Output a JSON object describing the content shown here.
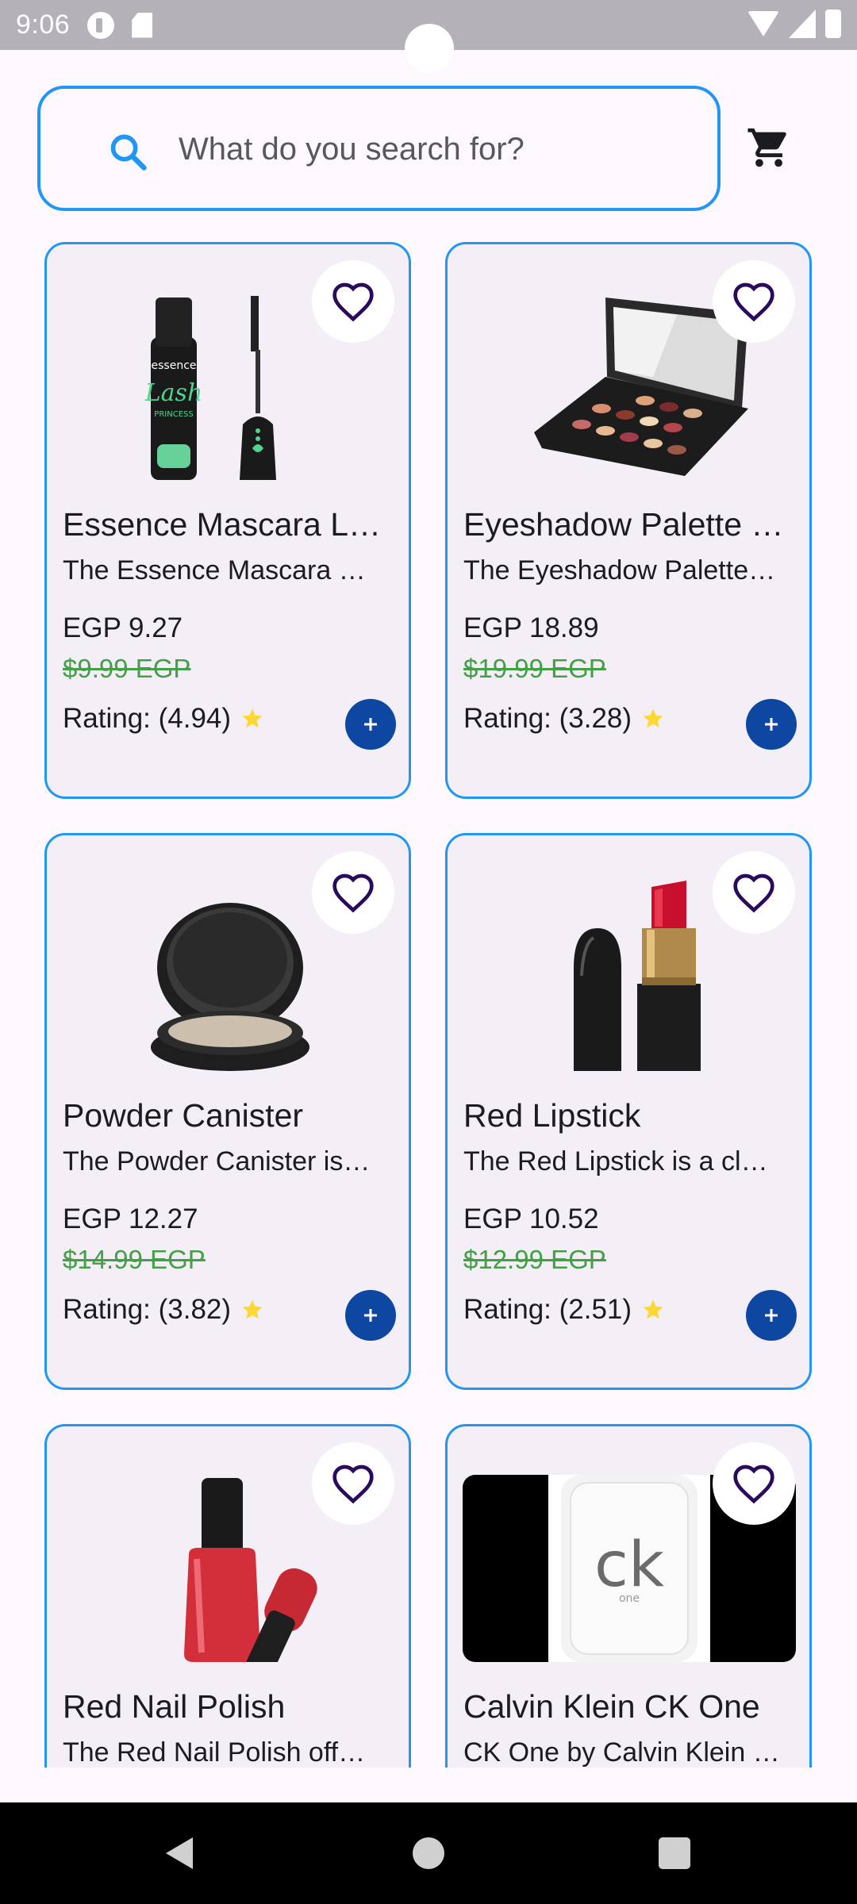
{
  "status_bar": {
    "time": "9:06",
    "icons": [
      "app-icon",
      "sd-card-icon",
      "wifi-icon",
      "signal-icon",
      "battery-icon"
    ]
  },
  "search": {
    "placeholder": "What do you search for?",
    "value": ""
  },
  "header": {
    "cart_icon": "shopping-cart-icon"
  },
  "colors": {
    "accent": "#2196f3",
    "add_button": "#0d47a1",
    "old_price": "#43a047",
    "star": "#fdd835",
    "card_bg": "#f4eff6",
    "page_bg": "#fdf7fe"
  },
  "products": [
    {
      "title": "Essence Mascara L…",
      "description": "The Essence Mascara …",
      "price": "EGP 9.27",
      "old_price": "$9.99 EGP",
      "rating": "Rating: (4.94)",
      "image": "mascara"
    },
    {
      "title": "Eyeshadow Palette …",
      "description": "The Eyeshadow Palette…",
      "price": "EGP 18.89",
      "old_price": "$19.99 EGP",
      "rating": "Rating: (3.28)",
      "image": "eyeshadow-palette"
    },
    {
      "title": "Powder Canister",
      "description": "The Powder Canister is…",
      "price": "EGP 12.27",
      "old_price": "$14.99 EGP",
      "rating": "Rating: (3.82)",
      "image": "powder-canister"
    },
    {
      "title": "Red Lipstick",
      "description": "The Red Lipstick is a cl…",
      "price": "EGP 10.52",
      "old_price": "$12.99 EGP",
      "rating": "Rating: (2.51)",
      "image": "lipstick"
    },
    {
      "title": "Red Nail Polish",
      "description": "The Red Nail Polish off…",
      "image": "nail-polish"
    },
    {
      "title": "Calvin Klein CK One",
      "description": "CK One by Calvin Klein …",
      "image": "perfume-bottle",
      "image_label": "ck",
      "image_sublabel": "one"
    }
  ]
}
